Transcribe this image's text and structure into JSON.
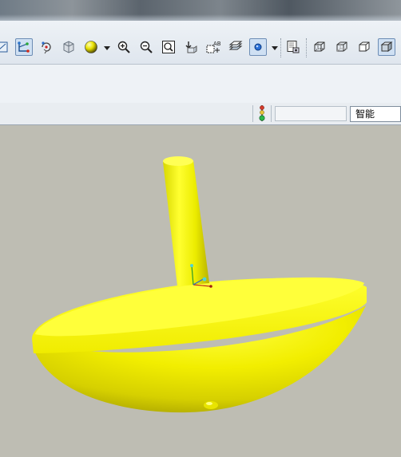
{
  "toolbar": {
    "buttons": [
      {
        "name": "sketch-view",
        "icon": "sketch-plane-icon"
      },
      {
        "name": "datum-display",
        "icon": "datum-axis-icon",
        "pressed": true
      },
      {
        "name": "spin-center",
        "icon": "spin-center-icon"
      },
      {
        "name": "orient",
        "icon": "orient-icon"
      },
      {
        "name": "appearance",
        "icon": "appearance-sphere-icon"
      },
      {
        "name": "zoom-in",
        "icon": "zoom-in-icon"
      },
      {
        "name": "zoom-out",
        "icon": "zoom-out-icon"
      },
      {
        "name": "refit",
        "icon": "refit-icon"
      },
      {
        "name": "view-manager",
        "icon": "view-manager-icon"
      },
      {
        "name": "annotations",
        "icon": "annotation-ab-icon"
      },
      {
        "name": "layers",
        "icon": "layers-icon"
      },
      {
        "name": "datum-points",
        "icon": "datum-point-icon",
        "pressed": true
      },
      {
        "name": "model-tree",
        "icon": "model-tree-icon"
      },
      {
        "name": "wireframe",
        "icon": "wireframe-icon"
      },
      {
        "name": "hidden-line",
        "icon": "hidden-line-icon"
      },
      {
        "name": "no-hidden",
        "icon": "no-hidden-icon"
      },
      {
        "name": "shading",
        "icon": "shading-icon",
        "pressed": true
      }
    ]
  },
  "status_bar": {
    "indicator_icon": "traffic-light-icon",
    "field_value": "",
    "filter_select": "智能"
  },
  "viewport": {
    "background": "#bebdb3",
    "model_color": "#ffff00",
    "model_icon": "spinning-top-model"
  }
}
